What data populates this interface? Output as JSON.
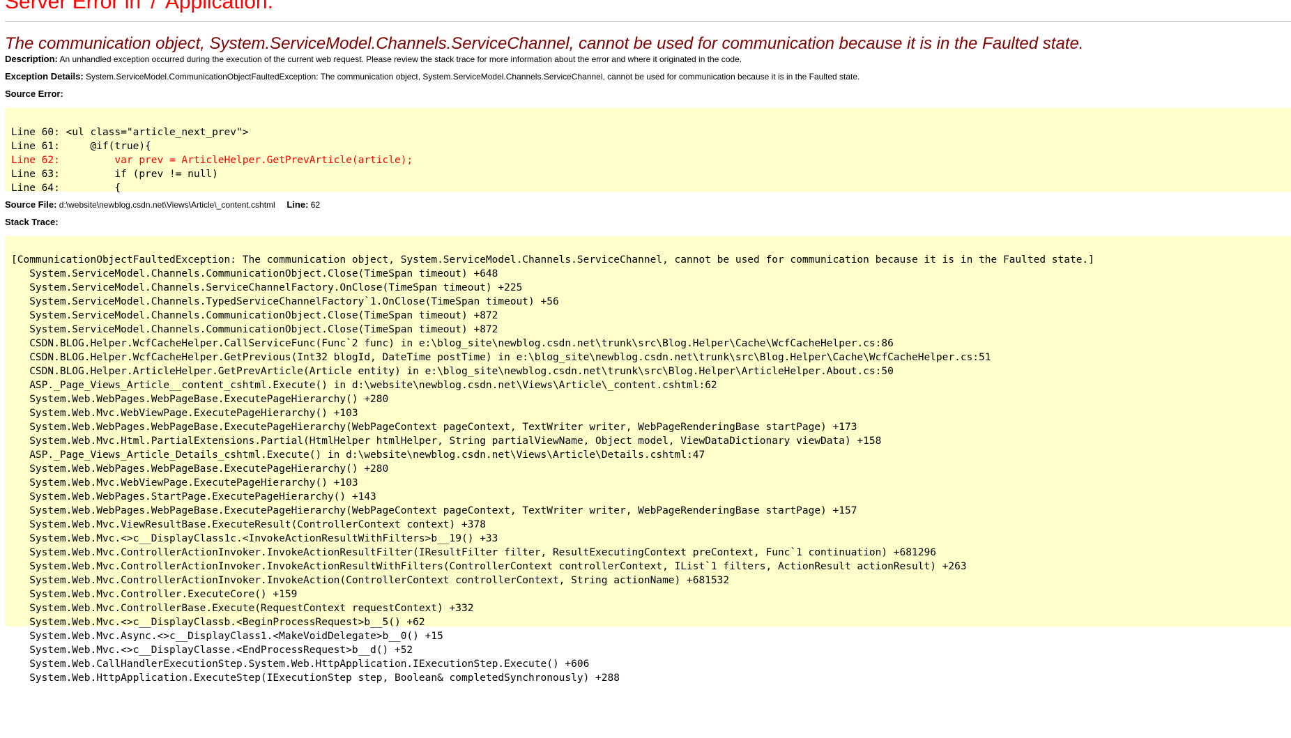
{
  "page": {
    "title": "Server Error in '/' Application.",
    "error_message": "The communication object, System.ServiceModel.Channels.ServiceChannel, cannot be used for communication because it is in the Faulted state.",
    "description_label": "Description:",
    "description_text": "An unhandled exception occurred during the execution of the current web request. Please review the stack trace for more information about the error and where it originated in the code.",
    "exception_label": "Exception Details:",
    "exception_text": "System.ServiceModel.CommunicationObjectFaultedException: The communication object, System.ServiceModel.Channels.ServiceChannel, cannot be used for communication because it is in the Faulted state.",
    "source_error_label": "Source Error:",
    "source_file_label": "Source File:",
    "source_file_path": "d:\\website\\newblog.csdn.net\\Views\\Article\\_content.cshtml",
    "line_label": "Line:",
    "line_number": "62",
    "stack_trace_label": "Stack Trace:",
    "colors": {
      "title": "#ff0000",
      "message": "#800000",
      "code_background": "#ffffcc",
      "highlight_line": "#ff0000"
    }
  },
  "source_lines": [
    {
      "text": "Line 60: <ul class=\"article_next_prev\">",
      "highlight": false
    },
    {
      "text": "Line 61:     @if(true){",
      "highlight": false
    },
    {
      "text": "Line 62:         var prev = ArticleHelper.GetPrevArticle(article);",
      "highlight": true
    },
    {
      "text": "Line 63:         if (prev != null)",
      "highlight": false
    },
    {
      "text": "Line 64:         {",
      "highlight": false
    }
  ],
  "stack_trace": [
    "[CommunicationObjectFaultedException: The communication object, System.ServiceModel.Channels.ServiceChannel, cannot be used for communication because it is in the Faulted state.]",
    "   System.ServiceModel.Channels.CommunicationObject.Close(TimeSpan timeout) +648",
    "   System.ServiceModel.Channels.ServiceChannelFactory.OnClose(TimeSpan timeout) +225",
    "   System.ServiceModel.Channels.TypedServiceChannelFactory`1.OnClose(TimeSpan timeout) +56",
    "   System.ServiceModel.Channels.CommunicationObject.Close(TimeSpan timeout) +872",
    "   System.ServiceModel.Channels.CommunicationObject.Close(TimeSpan timeout) +872",
    "   CSDN.BLOG.Helper.WcfCacheHelper.CallServiceFunc(Func`2 func) in e:\\blog_site\\newblog.csdn.net\\trunk\\src\\Blog.Helper\\Cache\\WcfCacheHelper.cs:86",
    "   CSDN.BLOG.Helper.WcfCacheHelper.GetPrevious(Int32 blogId, DateTime postTime) in e:\\blog_site\\newblog.csdn.net\\trunk\\src\\Blog.Helper\\Cache\\WcfCacheHelper.cs:51",
    "   CSDN.BLOG.Helper.ArticleHelper.GetPrevArticle(Article entity) in e:\\blog_site\\newblog.csdn.net\\trunk\\src\\Blog.Helper\\ArticleHelper.About.cs:50",
    "   ASP._Page_Views_Article__content_cshtml.Execute() in d:\\website\\newblog.csdn.net\\Views\\Article\\_content.cshtml:62",
    "   System.Web.WebPages.WebPageBase.ExecutePageHierarchy() +280",
    "   System.Web.Mvc.WebViewPage.ExecutePageHierarchy() +103",
    "   System.Web.WebPages.WebPageBase.ExecutePageHierarchy(WebPageContext pageContext, TextWriter writer, WebPageRenderingBase startPage) +173",
    "   System.Web.Mvc.Html.PartialExtensions.Partial(HtmlHelper htmlHelper, String partialViewName, Object model, ViewDataDictionary viewData) +158",
    "   ASP._Page_Views_Article_Details_cshtml.Execute() in d:\\website\\newblog.csdn.net\\Views\\Article\\Details.cshtml:47",
    "   System.Web.WebPages.WebPageBase.ExecutePageHierarchy() +280",
    "   System.Web.Mvc.WebViewPage.ExecutePageHierarchy() +103",
    "   System.Web.WebPages.StartPage.ExecutePageHierarchy() +143",
    "   System.Web.WebPages.WebPageBase.ExecutePageHierarchy(WebPageContext pageContext, TextWriter writer, WebPageRenderingBase startPage) +157",
    "   System.Web.Mvc.ViewResultBase.ExecuteResult(ControllerContext context) +378",
    "   System.Web.Mvc.<>c__DisplayClass1c.<InvokeActionResultWithFilters>b__19() +33",
    "   System.Web.Mvc.ControllerActionInvoker.InvokeActionResultFilter(IResultFilter filter, ResultExecutingContext preContext, Func`1 continuation) +681296",
    "   System.Web.Mvc.ControllerActionInvoker.InvokeActionResultWithFilters(ControllerContext controllerContext, IList`1 filters, ActionResult actionResult) +263",
    "   System.Web.Mvc.ControllerActionInvoker.InvokeAction(ControllerContext controllerContext, String actionName) +681532",
    "   System.Web.Mvc.Controller.ExecuteCore() +159",
    "   System.Web.Mvc.ControllerBase.Execute(RequestContext requestContext) +332",
    "   System.Web.Mvc.<>c__DisplayClassb.<BeginProcessRequest>b__5() +62",
    "   System.Web.Mvc.Async.<>c__DisplayClass1.<MakeVoidDelegate>b__0() +15",
    "   System.Web.Mvc.<>c__DisplayClasse.<EndProcessRequest>b__d() +52",
    "   System.Web.CallHandlerExecutionStep.System.Web.HttpApplication.IExecutionStep.Execute() +606",
    "   System.Web.HttpApplication.ExecuteStep(IExecutionStep step, Boolean& completedSynchronously) +288"
  ]
}
